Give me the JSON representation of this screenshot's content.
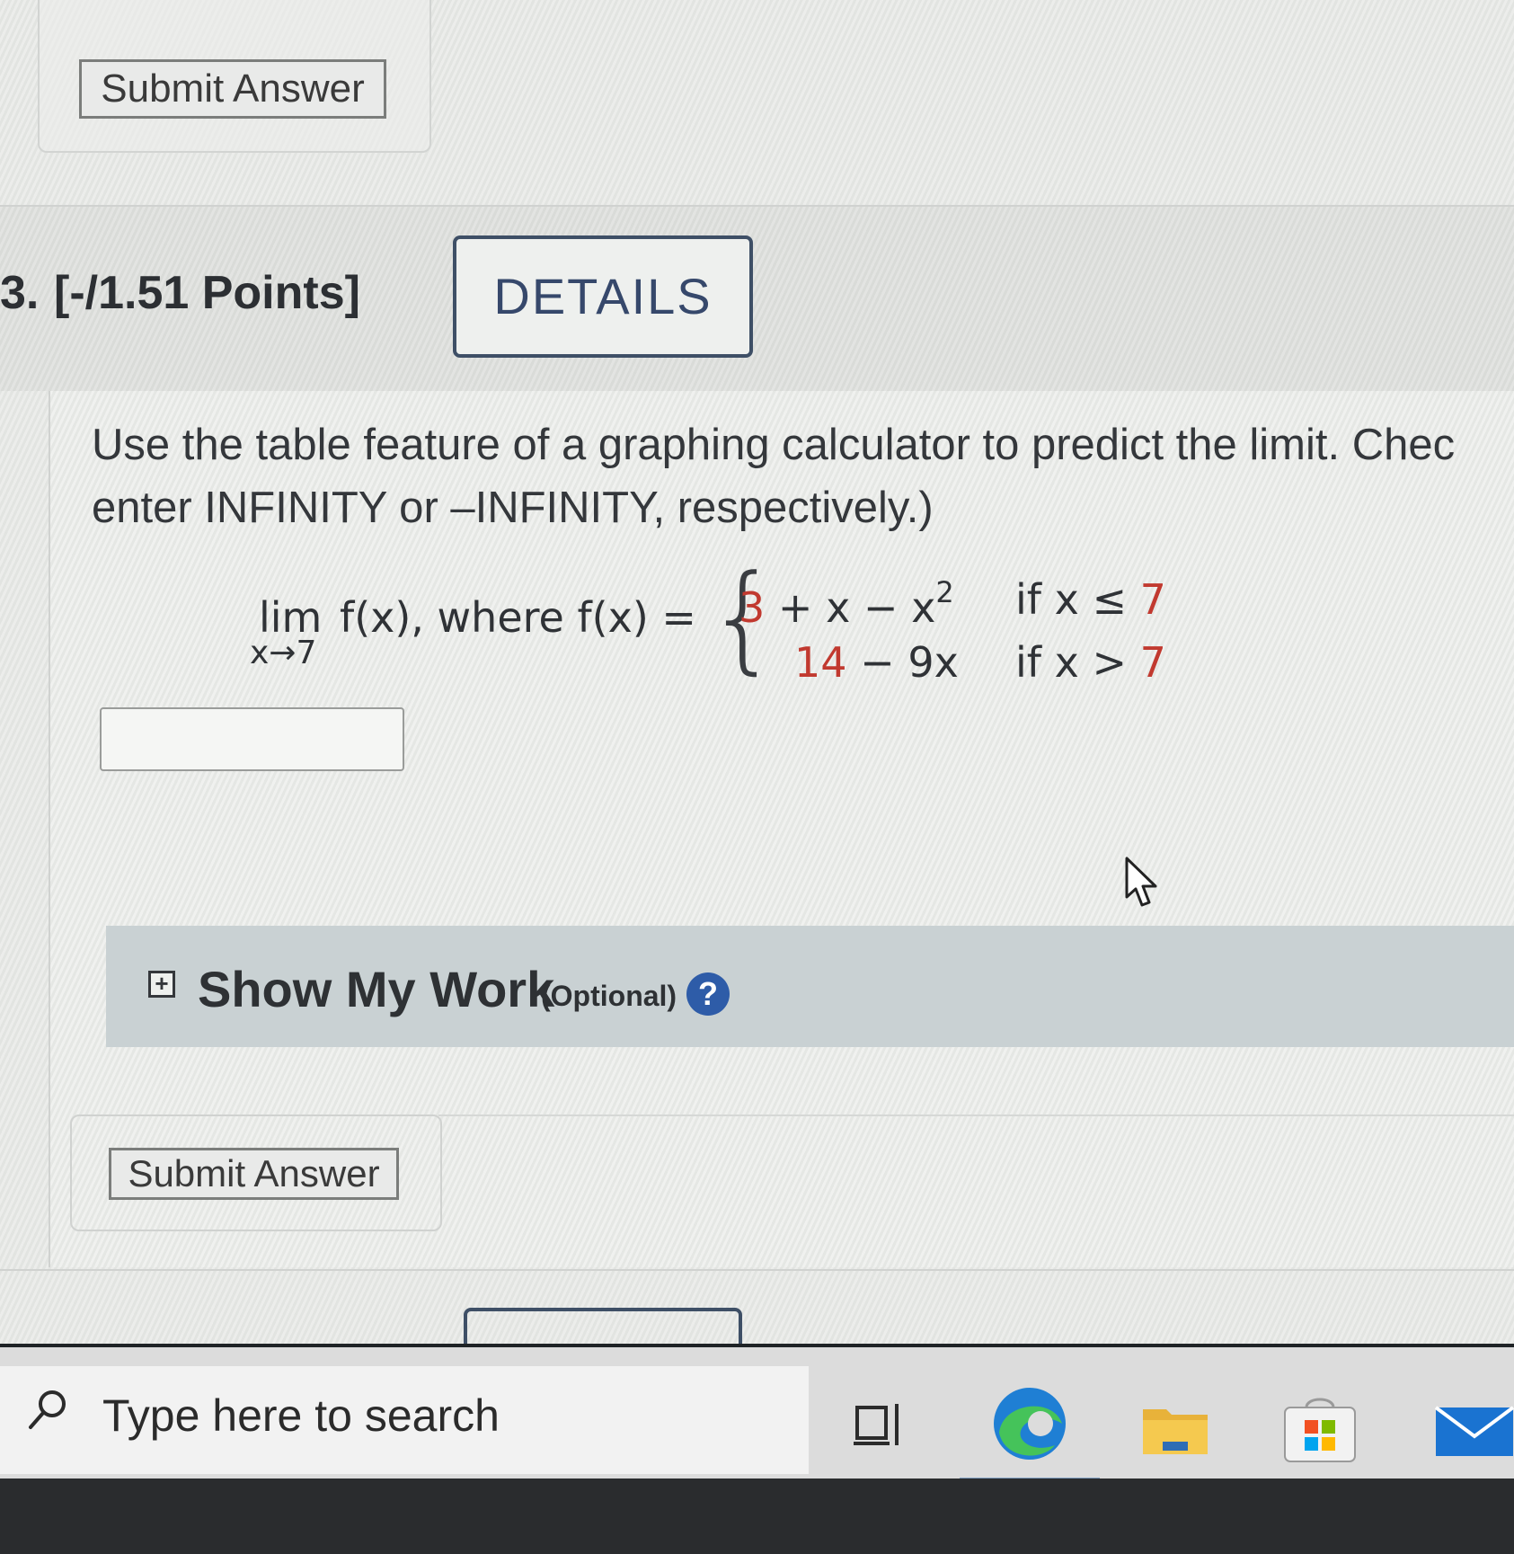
{
  "previous": {
    "submit_label": "Submit Answer"
  },
  "question": {
    "number": "3.",
    "points": "[-/1.51 Points]",
    "details_label": "DETAILS",
    "prompt_line1": "Use the table feature of a graphing calculator to predict the limit. Chec",
    "prompt_line2": "enter INFINITY or –INFINITY, respectively.)",
    "math": {
      "lim": "lim",
      "lim_sub": "x→7",
      "fx_text": "f(x), where f(x) =",
      "piece1_const": "3",
      "piece1_rest": " + x − x",
      "piece1_exp": "2",
      "piece2_const": "14",
      "piece2_rest": " − 9x",
      "cond1_text": "if x ≤ ",
      "cond1_val": "7",
      "cond2_text": "if x > ",
      "cond2_val": "7"
    },
    "answer_value": "",
    "show_my_work": {
      "icon": "plus-box-icon",
      "title": "Show My Work",
      "optional": "(Optional)",
      "help_symbol": "?"
    },
    "submit_label": "Submit Answer"
  },
  "taskbar": {
    "search_placeholder": "Type here to search",
    "icons": [
      "search-icon",
      "task-view-icon",
      "edge-icon",
      "file-explorer-icon",
      "store-icon",
      "mail-icon"
    ]
  },
  "colors": {
    "accent_red": "#c1392f",
    "details_border": "#3e4f66",
    "help_blue": "#2e5ca8"
  }
}
